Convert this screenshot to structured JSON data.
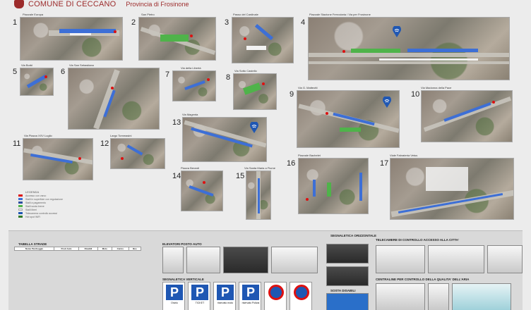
{
  "header": {
    "title": "COMUNE DI CECCANO",
    "subtitle": "Provincia di Frosinone"
  },
  "tiles": [
    {
      "n": "1",
      "caption": "Piazzale Europa"
    },
    {
      "n": "2",
      "caption": "San Pietro"
    },
    {
      "n": "3",
      "caption": "Passo del Cardinale"
    },
    {
      "n": "4",
      "caption": "Piazzale Stazione Ferroviaria / Via per Frosinone"
    },
    {
      "n": "5",
      "caption": "Via Borbi"
    },
    {
      "n": "6",
      "caption": "Via San Sebastiano"
    },
    {
      "n": "7",
      "caption": "Via della Libertà"
    },
    {
      "n": "8",
      "caption": "Via Sotto Castello"
    },
    {
      "n": "9",
      "caption": "Via G. Matteotti"
    },
    {
      "n": "10",
      "caption": "Via Madonna della Pace"
    },
    {
      "n": "11",
      "caption": "Via Piazza XXV Luglio"
    },
    {
      "n": "12",
      "caption": "Largo Tommasini"
    },
    {
      "n": "13",
      "caption": "Via Magenta"
    },
    {
      "n": "14",
      "caption": "Piazza Berardi"
    },
    {
      "n": "15",
      "caption": "Via Santa Maria a Fiume"
    },
    {
      "n": "16",
      "caption": "Piazzale Bachelet"
    },
    {
      "n": "17",
      "caption": "Viale Fabrateria Vetus"
    }
  ],
  "legend": {
    "title": "LEGENDA",
    "items": [
      {
        "label": "Accesso con varco",
        "color": "#d11"
      },
      {
        "label": "Stalli in superficie con regolazione",
        "color": "#3d6fd6"
      },
      {
        "label": "Stalli a pagamento",
        "color": "#2b4ea0"
      },
      {
        "label": "Stalli sosta breve",
        "color": "#4fb34a"
      },
      {
        "label": "Stalli liberi",
        "color": "#f2f2f2"
      },
      {
        "label": "Telecamera controllo accessi",
        "color": "#1f57b3"
      },
      {
        "label": "Hot spot WiFi",
        "color": "#2f7a2a"
      }
    ]
  },
  "panel": {
    "table_title": "TABELLA STRADE",
    "table_headers": [
      "Nome Parcheggio",
      "Posti Auto",
      "Disabili",
      "Moto",
      "Carico",
      "Bus"
    ],
    "elevators_title": "ELEVATORI POSTO AUTO",
    "vertical_title": "SEGNALETICA VERTICALE",
    "horizontal_title": "SEGNALETICA ORIZZONTALE",
    "horizontal_sub": "SOSTA DISABILI",
    "cameras_title": "TELECAMERE DI CONTROLLO ACCESSO ALLA CITTA'",
    "air_title": "CENTRALINE PER CONTROLLO DELLA QUALITA' DELL'ARIA",
    "signs": [
      {
        "letter": "P",
        "label": "Orario"
      },
      {
        "letter": "P",
        "label": "TICKET"
      },
      {
        "letter": "P",
        "label": "riservato moto"
      },
      {
        "letter": "P",
        "label": "riservato Polizia"
      },
      {
        "letter": "",
        "label": ""
      },
      {
        "letter": "",
        "label": ""
      }
    ]
  }
}
